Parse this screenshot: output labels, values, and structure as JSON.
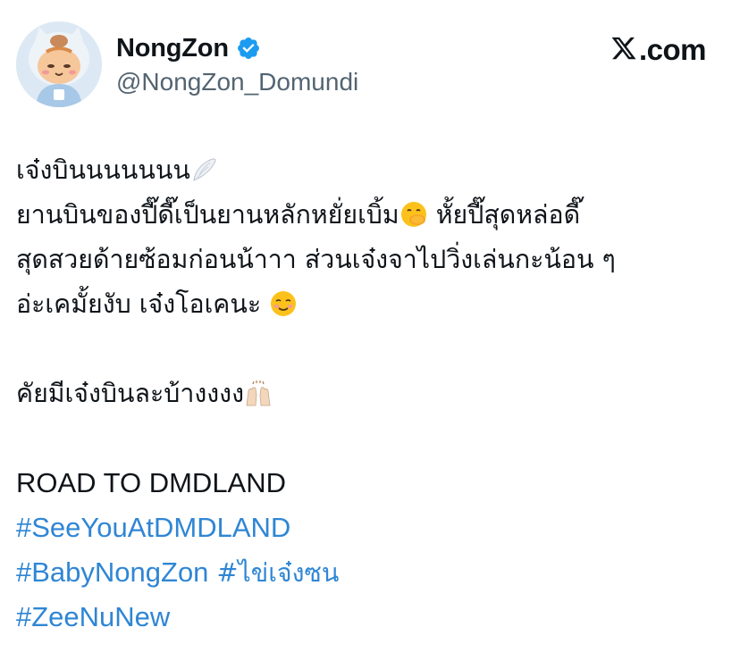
{
  "author": {
    "display_name": "NongZon",
    "handle": "@NongZon_Domundi",
    "verified": true,
    "avatar": "cat-mascot-avatar"
  },
  "brand": {
    "logo": "x-logo-icon",
    "label": ".com"
  },
  "tweet": {
    "line1": "เจ๋งบินนนนนนน",
    "line2a": "ยานบินของปี๊ดี๊เป็นยานหลักหยั่ยเบิ้ม",
    "line2b": " หั้ยปี๊สุดหล่อดี๊",
    "line3": "สุดสวยด้ายซ้อมก่อนน้าาา ส่วนเจ๋งจาไปวิ่งเล่นกะน้อน ๆ",
    "line4": "อ่ะเคมั้ยงับ เจ๋งโอเคนะ ",
    "line5": "คัยมีเจ๋งบินละบ้างงงง",
    "road": "ROAD TO DMDLAND",
    "hashtags": [
      "#SeeYouAtDMDLAND",
      "#BabyNongZon",
      "#ไข่เจ๋งซน",
      "#ZeeNuNew"
    ]
  },
  "emojis": {
    "wing": "wing-emoji",
    "hand_over_mouth": "face-with-hand-over-mouth-emoji",
    "smiling": "smiling-face-emoji",
    "raising_hands": "raising-hands-emoji"
  },
  "colors": {
    "text": "#0f1419",
    "secondary": "#536471",
    "link": "#2f86d4",
    "verified": "#1d9bf0"
  }
}
